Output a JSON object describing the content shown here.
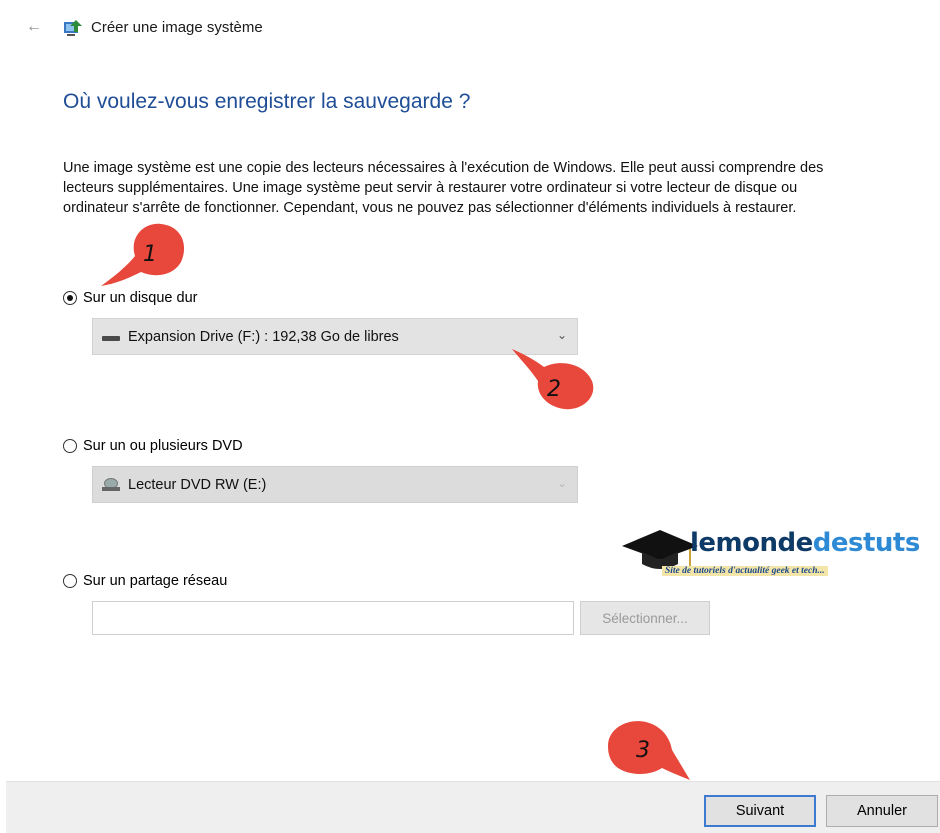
{
  "window": {
    "back_glyph": "←",
    "title": "Créer une image système",
    "icon": "system-image-icon"
  },
  "heading": "Où voulez-vous enregistrer la sauvegarde ?",
  "description": "Une image système est une copie des lecteurs nécessaires à l'exécution de Windows. Elle peut aussi comprendre des lecteurs supplémentaires. Une image système peut servir à restaurer votre ordinateur si votre lecteur de disque ou ordinateur s'arrête de fonctionner. Cependant, vous ne pouvez pas sélectionner d'éléments individuels à restaurer.",
  "options": {
    "hard_disk": {
      "label": "Sur un disque dur",
      "selected": true,
      "dropdown_value": "Expansion Drive (F:) : 192,38 Go de libres"
    },
    "dvd": {
      "label": "Sur un ou plusieurs DVD",
      "selected": false,
      "dropdown_value": "Lecteur DVD RW (E:)"
    },
    "network": {
      "label": "Sur un partage réseau",
      "selected": false,
      "input_value": "",
      "select_button": "Sélectionner..."
    }
  },
  "buttons": {
    "next": "Suivant",
    "cancel": "Annuler"
  },
  "watermark": {
    "name_part1": "lemonde",
    "name_part2": "destuts",
    "tagline": "Site de tutoriels d'actualité geek et tech..."
  },
  "annotations": {
    "marker_1": "1",
    "marker_2": "2",
    "marker_3": "3"
  },
  "colors": {
    "heading": "#1f4e97",
    "marker": "#e8473c",
    "primary_border": "#3e7ad0"
  }
}
